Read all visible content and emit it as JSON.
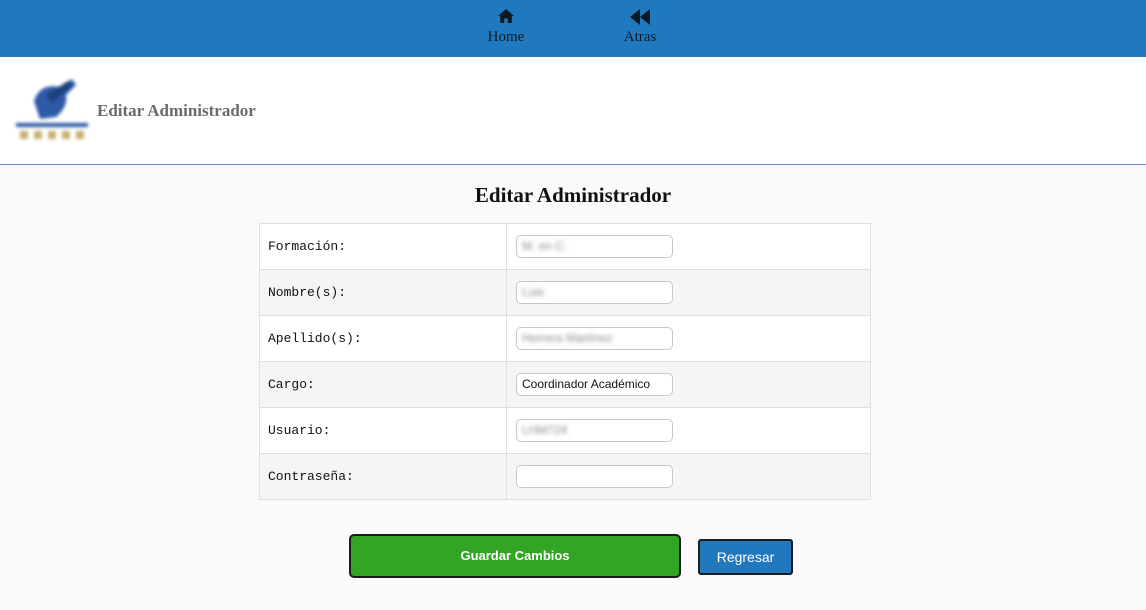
{
  "nav": {
    "home": {
      "label": "Home",
      "icon": "home-icon"
    },
    "back": {
      "label": "Atras",
      "icon": "backward-icon"
    }
  },
  "header": {
    "title": "Editar Administrador"
  },
  "form": {
    "title": "Editar Administrador",
    "fields": [
      {
        "label": "Formación:",
        "value": "M. en C."
      },
      {
        "label": "Nombre(s):",
        "value": "Luis"
      },
      {
        "label": "Apellido(s):",
        "value": "Herrera Martínez"
      },
      {
        "label": "Cargo:",
        "value": "Coordinador Académico"
      },
      {
        "label": "Usuario:",
        "value": "LHM724"
      },
      {
        "label": "Contraseña:",
        "value": ""
      }
    ]
  },
  "buttons": {
    "save": "Guardar Cambios",
    "back": "Regresar"
  },
  "colors": {
    "nav_bg": "#2079be",
    "save_bg": "#33a524",
    "back_bg": "#2079be"
  }
}
